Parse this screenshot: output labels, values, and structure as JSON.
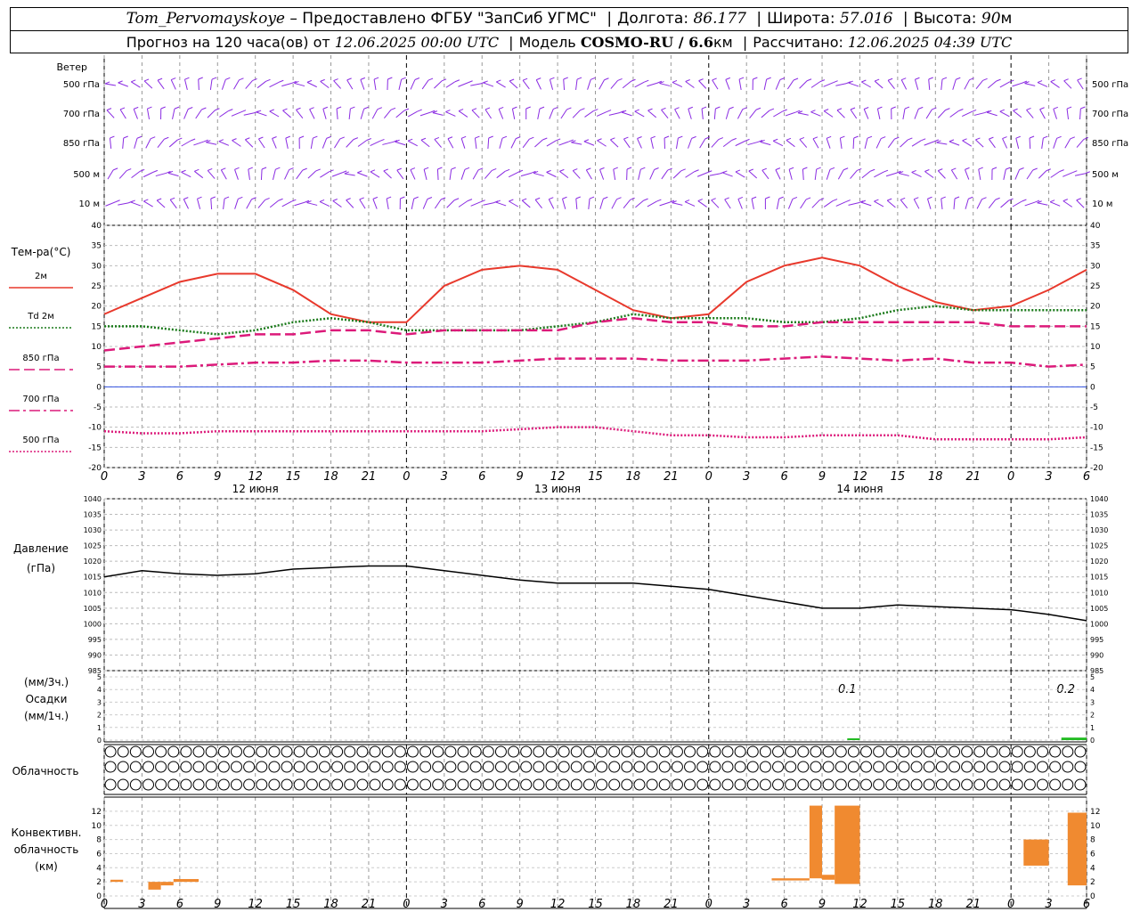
{
  "header": {
    "station": "Tom_Pervomayskoye",
    "provided_by": "– Предоставлено ФГБУ \"ЗапСиб УГМС\"",
    "lon_label": "Долгота:",
    "lon": "86.177",
    "lat_label": "Широта:",
    "lat": "57.016",
    "alt_label": "Высота:",
    "alt": "90",
    "alt_unit": "м",
    "forecast_label": "Прогноз на 120 часа(ов) от",
    "forecast_from": "12.06.2025 00:00 UTC",
    "model_label": "Модель",
    "model": "COSMO-RU / 6.6",
    "model_unit": "км",
    "computed_label": "Рассчитано:",
    "computed": "12.06.2025 04:39 UTC"
  },
  "wind_panel": {
    "title": "Ветер",
    "levels": [
      "500 гПа",
      "700 гПа",
      "850 гПа",
      "500 м",
      "10 м"
    ],
    "color": "#8a2be2"
  },
  "temp_panel": {
    "title": "Тем-ра(°C)",
    "y_ticks": [
      40,
      35,
      30,
      25,
      20,
      15,
      10,
      5,
      0,
      -5,
      -10,
      -15,
      -20
    ],
    "legend": [
      {
        "label": "2м",
        "color": "#e8392c",
        "style": "solid"
      },
      {
        "label_prefix": "Td",
        "label": "2м",
        "color": "#1a7a1a",
        "style": "dotted"
      },
      {
        "label": "850 гПа",
        "color": "#dc1a7a",
        "style": "dashed"
      },
      {
        "label": "700 гПа",
        "color": "#dc1a7a",
        "style": "dashdot"
      },
      {
        "label": "500 гПа",
        "color": "#dc1a7a",
        "style": "dotted"
      }
    ]
  },
  "time_axis": {
    "hour_labels": [
      "0",
      "3",
      "6",
      "9",
      "12",
      "15",
      "18",
      "21",
      "0",
      "3",
      "6",
      "9",
      "12",
      "15",
      "18",
      "21",
      "0",
      "3",
      "6",
      "9",
      "12",
      "15",
      "18",
      "21",
      "0",
      "3",
      "6"
    ],
    "dates": [
      "12 июня",
      "13 июня",
      "14 июня"
    ]
  },
  "pressure_panel": {
    "title": "Давление",
    "unit": "(гПа)",
    "y_ticks": [
      1040,
      1035,
      1030,
      1025,
      1020,
      1015,
      1010,
      1005,
      1000,
      995,
      990,
      985
    ]
  },
  "precip_panel": {
    "unit_top": "(мм/3ч.)",
    "title": "Осадки",
    "unit_bottom": "(мм/1ч.)",
    "y_ticks": [
      5,
      4,
      3,
      2,
      1,
      0
    ],
    "annotations": [
      "0.1",
      "0.2"
    ]
  },
  "cloud_panel": {
    "title": "Облачность"
  },
  "convective_panel": {
    "title_1": "Конвективн.",
    "title_2": "облачность",
    "unit": "(км)",
    "y_ticks": [
      12,
      10,
      8,
      6,
      4,
      2,
      0
    ],
    "color": "#f08a30"
  },
  "chart_data": [
    {
      "type": "line",
      "title": "Тем-ра(°C)",
      "ylim": [
        -20,
        40
      ],
      "x_hours": [
        0,
        3,
        6,
        9,
        12,
        15,
        18,
        21,
        24,
        27,
        30,
        33,
        36,
        39,
        42,
        45,
        48,
        51,
        54,
        57,
        60,
        63,
        66,
        69,
        72,
        75,
        78
      ],
      "series": [
        {
          "name": "2м",
          "values": [
            18,
            22,
            26,
            28,
            28,
            24,
            18,
            16,
            16,
            25,
            29,
            30,
            29,
            24,
            19,
            17,
            18,
            26,
            30,
            32,
            30,
            25,
            21,
            19,
            20,
            24,
            29
          ]
        },
        {
          "name": "Td 2м",
          "values": [
            15,
            15,
            14,
            13,
            14,
            16,
            17,
            16,
            14,
            14,
            14,
            14,
            15,
            16,
            18,
            17,
            17,
            17,
            16,
            16,
            17,
            19,
            20,
            19,
            19,
            19,
            19
          ]
        },
        {
          "name": "850 гПа",
          "values": [
            9,
            10,
            11,
            12,
            13,
            13,
            14,
            14,
            13,
            14,
            14,
            14,
            14,
            16,
            17,
            16,
            16,
            15,
            15,
            16,
            16,
            16,
            16,
            16,
            15,
            15,
            15
          ]
        },
        {
          "name": "700 гПа",
          "values": [
            5,
            5,
            5,
            5.5,
            6,
            6,
            6.5,
            6.5,
            6,
            6,
            6,
            6.5,
            7,
            7,
            7,
            6.5,
            6.5,
            6.5,
            7,
            7.5,
            7,
            6.5,
            7,
            6,
            6,
            5,
            5.5
          ]
        },
        {
          "name": "500 гПа",
          "values": [
            -11,
            -11.5,
            -11.5,
            -11,
            -11,
            -11,
            -11,
            -11,
            -11,
            -11,
            -11,
            -10.5,
            -10,
            -10,
            -11,
            -12,
            -12,
            -12.5,
            -12.5,
            -12,
            -12,
            -12,
            -13,
            -13,
            -13,
            -13,
            -12.5
          ]
        }
      ]
    },
    {
      "type": "line",
      "title": "Давление",
      "ylim": [
        985,
        1040
      ],
      "x_hours": [
        0,
        3,
        6,
        9,
        12,
        15,
        18,
        21,
        24,
        27,
        30,
        33,
        36,
        39,
        42,
        45,
        48,
        51,
        54,
        57,
        60,
        63,
        66,
        69,
        72,
        75,
        78
      ],
      "series": [
        {
          "name": "Давление",
          "values": [
            1015,
            1017,
            1016,
            1015.5,
            1016,
            1017.5,
            1018,
            1018.5,
            1018.5,
            1017,
            1015.5,
            1014,
            1013,
            1013,
            1013,
            1012,
            1011,
            1009,
            1007,
            1005,
            1005,
            1006,
            1005.5,
            1005,
            1004.5,
            1003,
            1001
          ]
        }
      ]
    },
    {
      "type": "bar",
      "title": "Осадки",
      "ylim": [
        0,
        5
      ],
      "bars": [
        {
          "start_hour": 59,
          "end_hour": 60,
          "value": 0.1
        },
        {
          "start_hour": 76,
          "end_hour": 78,
          "value": 0.2
        }
      ]
    },
    {
      "type": "bar",
      "title": "Конвективн. облачность",
      "ylim": [
        0,
        13
      ],
      "bars": [
        {
          "start_hour": 0.5,
          "end_hour": 1.5,
          "bottom": 2,
          "top": 2.3
        },
        {
          "start_hour": 3.5,
          "end_hour": 4.5,
          "bottom": 0.9,
          "top": 2
        },
        {
          "start_hour": 4.5,
          "end_hour": 5.5,
          "bottom": 1.5,
          "top": 2
        },
        {
          "start_hour": 5.5,
          "end_hour": 7.5,
          "bottom": 2,
          "top": 2.4
        },
        {
          "start_hour": 53,
          "end_hour": 56,
          "bottom": 2.2,
          "top": 2.5
        },
        {
          "start_hour": 56,
          "end_hour": 57,
          "bottom": 2.5,
          "top": 12.8
        },
        {
          "start_hour": 57,
          "end_hour": 58,
          "bottom": 2.3,
          "top": 3
        },
        {
          "start_hour": 58,
          "end_hour": 60,
          "bottom": 1.7,
          "top": 12.8
        },
        {
          "start_hour": 73,
          "end_hour": 75,
          "bottom": 4.3,
          "top": 8
        },
        {
          "start_hour": 76.5,
          "end_hour": 78,
          "bottom": 1.5,
          "top": 11.8
        }
      ]
    }
  ]
}
